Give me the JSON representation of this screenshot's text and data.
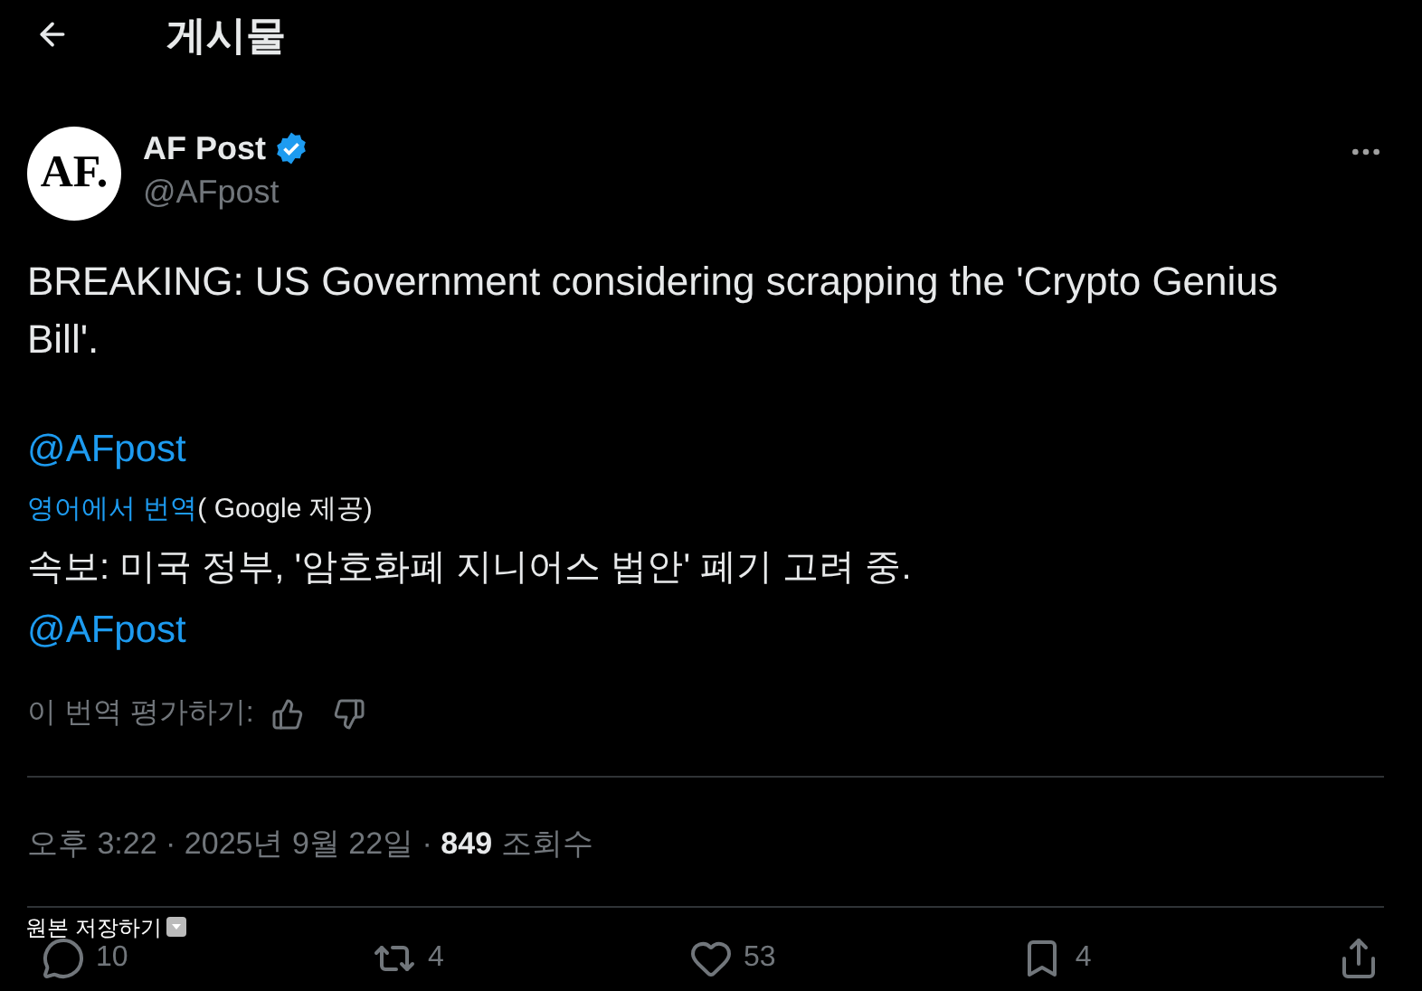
{
  "header": {
    "title": "게시물"
  },
  "author": {
    "name": "AF Post",
    "handle": "@AFpost",
    "avatar_text": "AF.",
    "verified": true
  },
  "post": {
    "text": "BREAKING: US Government considering scrapping the 'Crypto Genius Bill'.",
    "mention": "@AFpost"
  },
  "translation": {
    "label": "영어에서 번역",
    "provider": "( Google 제공)",
    "text": "속보: 미국 정부, '암호화폐 지니어스 법안' 폐기 고려 중.",
    "mention": "@AFpost",
    "rate_label": "이 번역 평가하기:"
  },
  "meta": {
    "time": "오후 3:22 · 2025년 9월 22일 · ",
    "views": "849",
    "views_label": " 조회수"
  },
  "actions": [
    {
      "kind": "reply",
      "count": "10"
    },
    {
      "kind": "repost",
      "count": "4"
    },
    {
      "kind": "like",
      "count": "53"
    },
    {
      "kind": "bookmark",
      "count": "4"
    },
    {
      "kind": "share"
    }
  ],
  "overlay": {
    "label": "원본 저장하기"
  }
}
